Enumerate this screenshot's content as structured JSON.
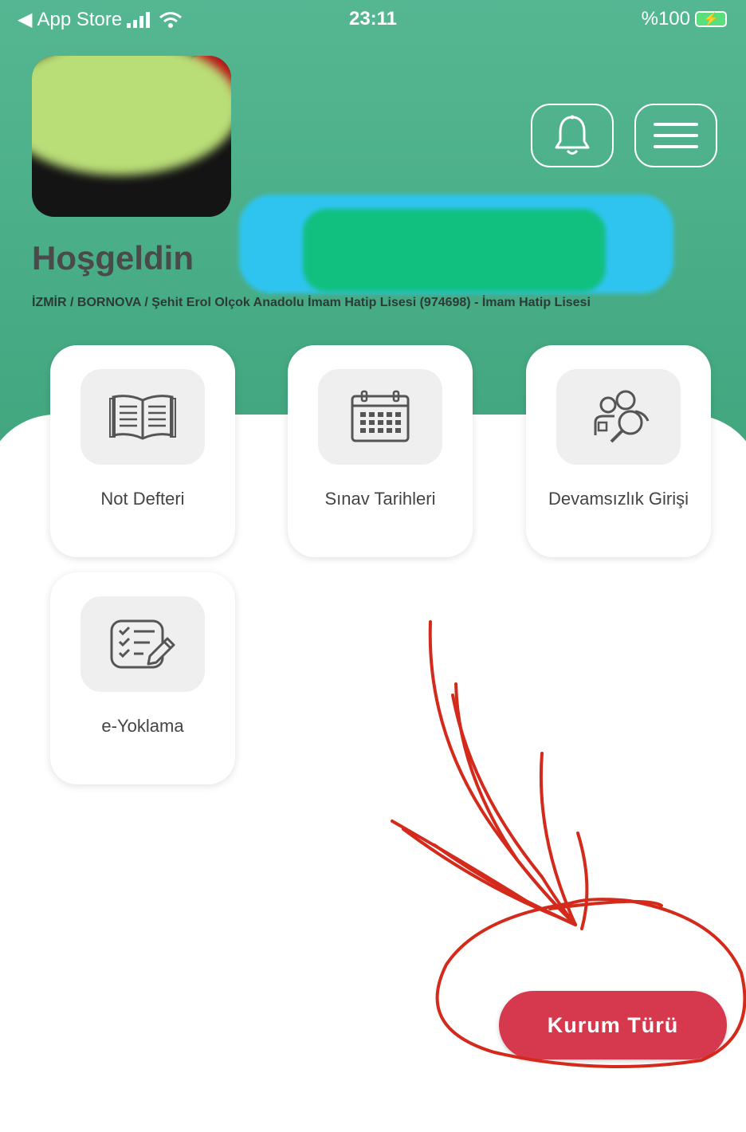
{
  "status_bar": {
    "back_app": "App Store",
    "time": "23:11",
    "battery": "%100"
  },
  "header": {
    "welcome": "Hoşgeldin",
    "school_info": "İZMİR / BORNOVA / Şehit Erol Olçok Anadolu İmam Hatip Lisesi (974698) - İmam Hatip Lisesi"
  },
  "menu": [
    {
      "label": "Not Defteri",
      "icon": "book-icon"
    },
    {
      "label": "Sınav Tarihleri",
      "icon": "calendar-icon"
    },
    {
      "label": "Devamsızlık Girişi",
      "icon": "people-search-icon"
    },
    {
      "label": "e-Yoklama",
      "icon": "checklist-icon"
    }
  ],
  "fab": {
    "label": "Kurum Türü"
  },
  "colors": {
    "header_green": "#4caf88",
    "fab_red": "#d6384d",
    "annotation_red": "#d42a1c"
  }
}
